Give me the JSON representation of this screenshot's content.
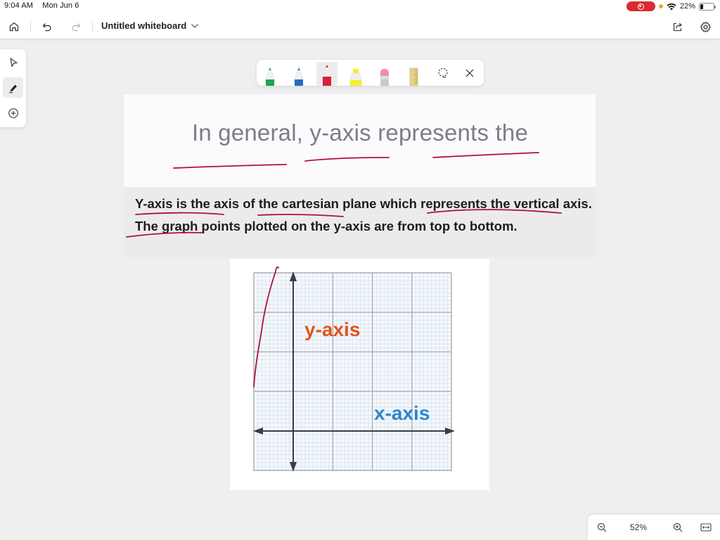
{
  "status_bar": {
    "time": "9:04 AM",
    "date": "Mon Jun 6",
    "battery_percent": "22%",
    "battery_level": 0.22,
    "recording_color": "#d92b2f"
  },
  "header": {
    "title": "Untitled whiteboard",
    "icons": {
      "home": "home-icon",
      "undo": "undo-icon",
      "redo": "redo-icon",
      "title_menu": "chevron-down-icon",
      "share": "share-icon",
      "settings": "gear-icon"
    }
  },
  "left_toolbar": {
    "items": [
      {
        "name": "select",
        "icon": "pointer-icon",
        "active": false
      },
      {
        "name": "pen",
        "icon": "pen-icon",
        "active": true
      },
      {
        "name": "add",
        "icon": "plus-circle-icon",
        "active": false
      }
    ]
  },
  "pen_toolbar": {
    "pens": [
      {
        "name": "green-pen",
        "color": "#1fa54e"
      },
      {
        "name": "blue-pen",
        "color": "#1f6fc0"
      },
      {
        "name": "red-pen",
        "color": "#d61f3c",
        "active": true
      },
      {
        "name": "yellow-highlighter",
        "color": "#f2f22a"
      },
      {
        "name": "eraser",
        "color": "#f28ca3"
      },
      {
        "name": "ruler",
        "color": "#e8d08a"
      }
    ],
    "lasso_icon": "lasso-icon",
    "close_icon": "close-icon"
  },
  "canvas": {
    "question_text": "In general, y-axis represents the",
    "answer_text": "Y-axis is the axis of the cartesian plane which represents the vertical axis. The graph points plotted on the y-axis are from top to bottom.",
    "graph": {
      "y_label": "y-axis",
      "x_label": "x-axis",
      "y_label_color": "#e0561e",
      "x_label_color": "#2b86cf"
    },
    "ink_color": "#b0103a"
  },
  "zoom_controls": {
    "zoom_level": "52%",
    "zoom_out_icon": "zoom-out-icon",
    "zoom_in_icon": "zoom-in-icon",
    "fit_icon": "fit-width-icon"
  }
}
